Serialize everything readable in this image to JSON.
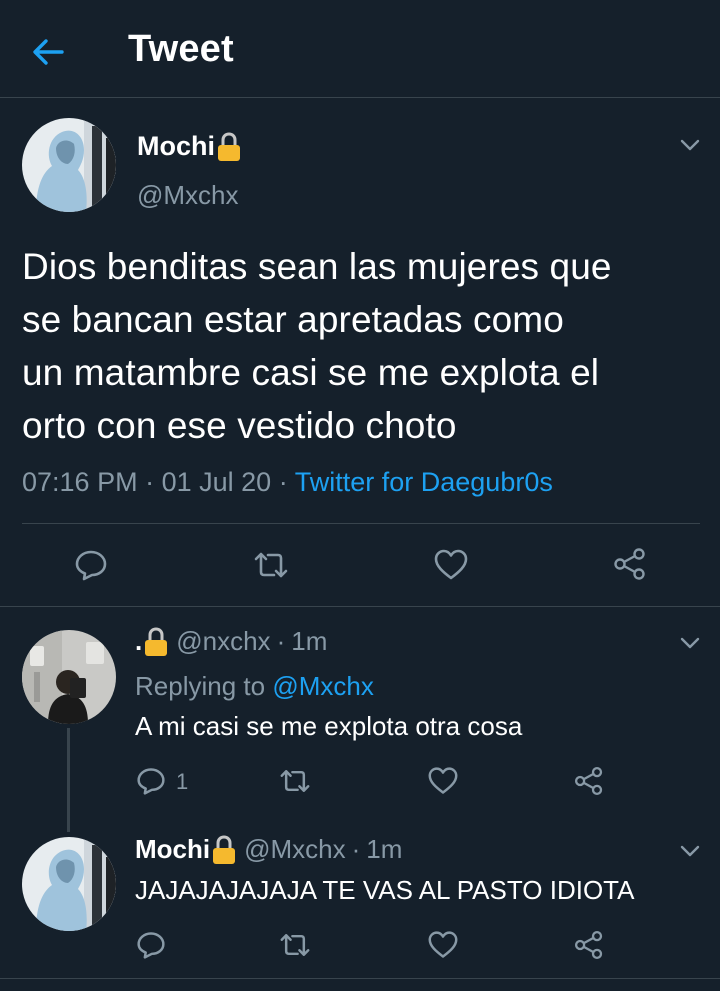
{
  "header": {
    "title": "Tweet",
    "accent": "#1da1f2"
  },
  "main_tweet": {
    "name": "Mochi",
    "handle": "@Mxchx",
    "text": "Dios benditas sean las mujeres que\nse bancan estar apretadas como\nun matambre casi se me explota el\norto con ese vestido choto",
    "time": "07:16 PM",
    "date": "01 Jul 20",
    "client": "Twitter for Daegubr0s",
    "separator": "·"
  },
  "replies": [
    {
      "name": ".",
      "handle": "@nxchx",
      "time": "1m",
      "replying_prefix": "Replying to",
      "replying_to": "@Mxchx",
      "text": "A mi casi se me explota otra cosa",
      "reply_count": "1"
    },
    {
      "name": "Mochi",
      "handle": "@Mxchx",
      "time": "1m",
      "text": "JAJAJAJAJAJA TE VAS AL PASTO IDIOTA"
    }
  ],
  "icons": {
    "back": "arrow-left-icon",
    "lock": "lock-icon",
    "caret": "chevron-down-icon",
    "reply": "reply-icon",
    "retweet": "retweet-icon",
    "like": "heart-icon",
    "share": "share-icon"
  },
  "colors": {
    "background": "#15202b",
    "secondary_text": "#8899a6",
    "divider": "#38444d",
    "link": "#1da1f2",
    "lock": "#f5b92e"
  }
}
